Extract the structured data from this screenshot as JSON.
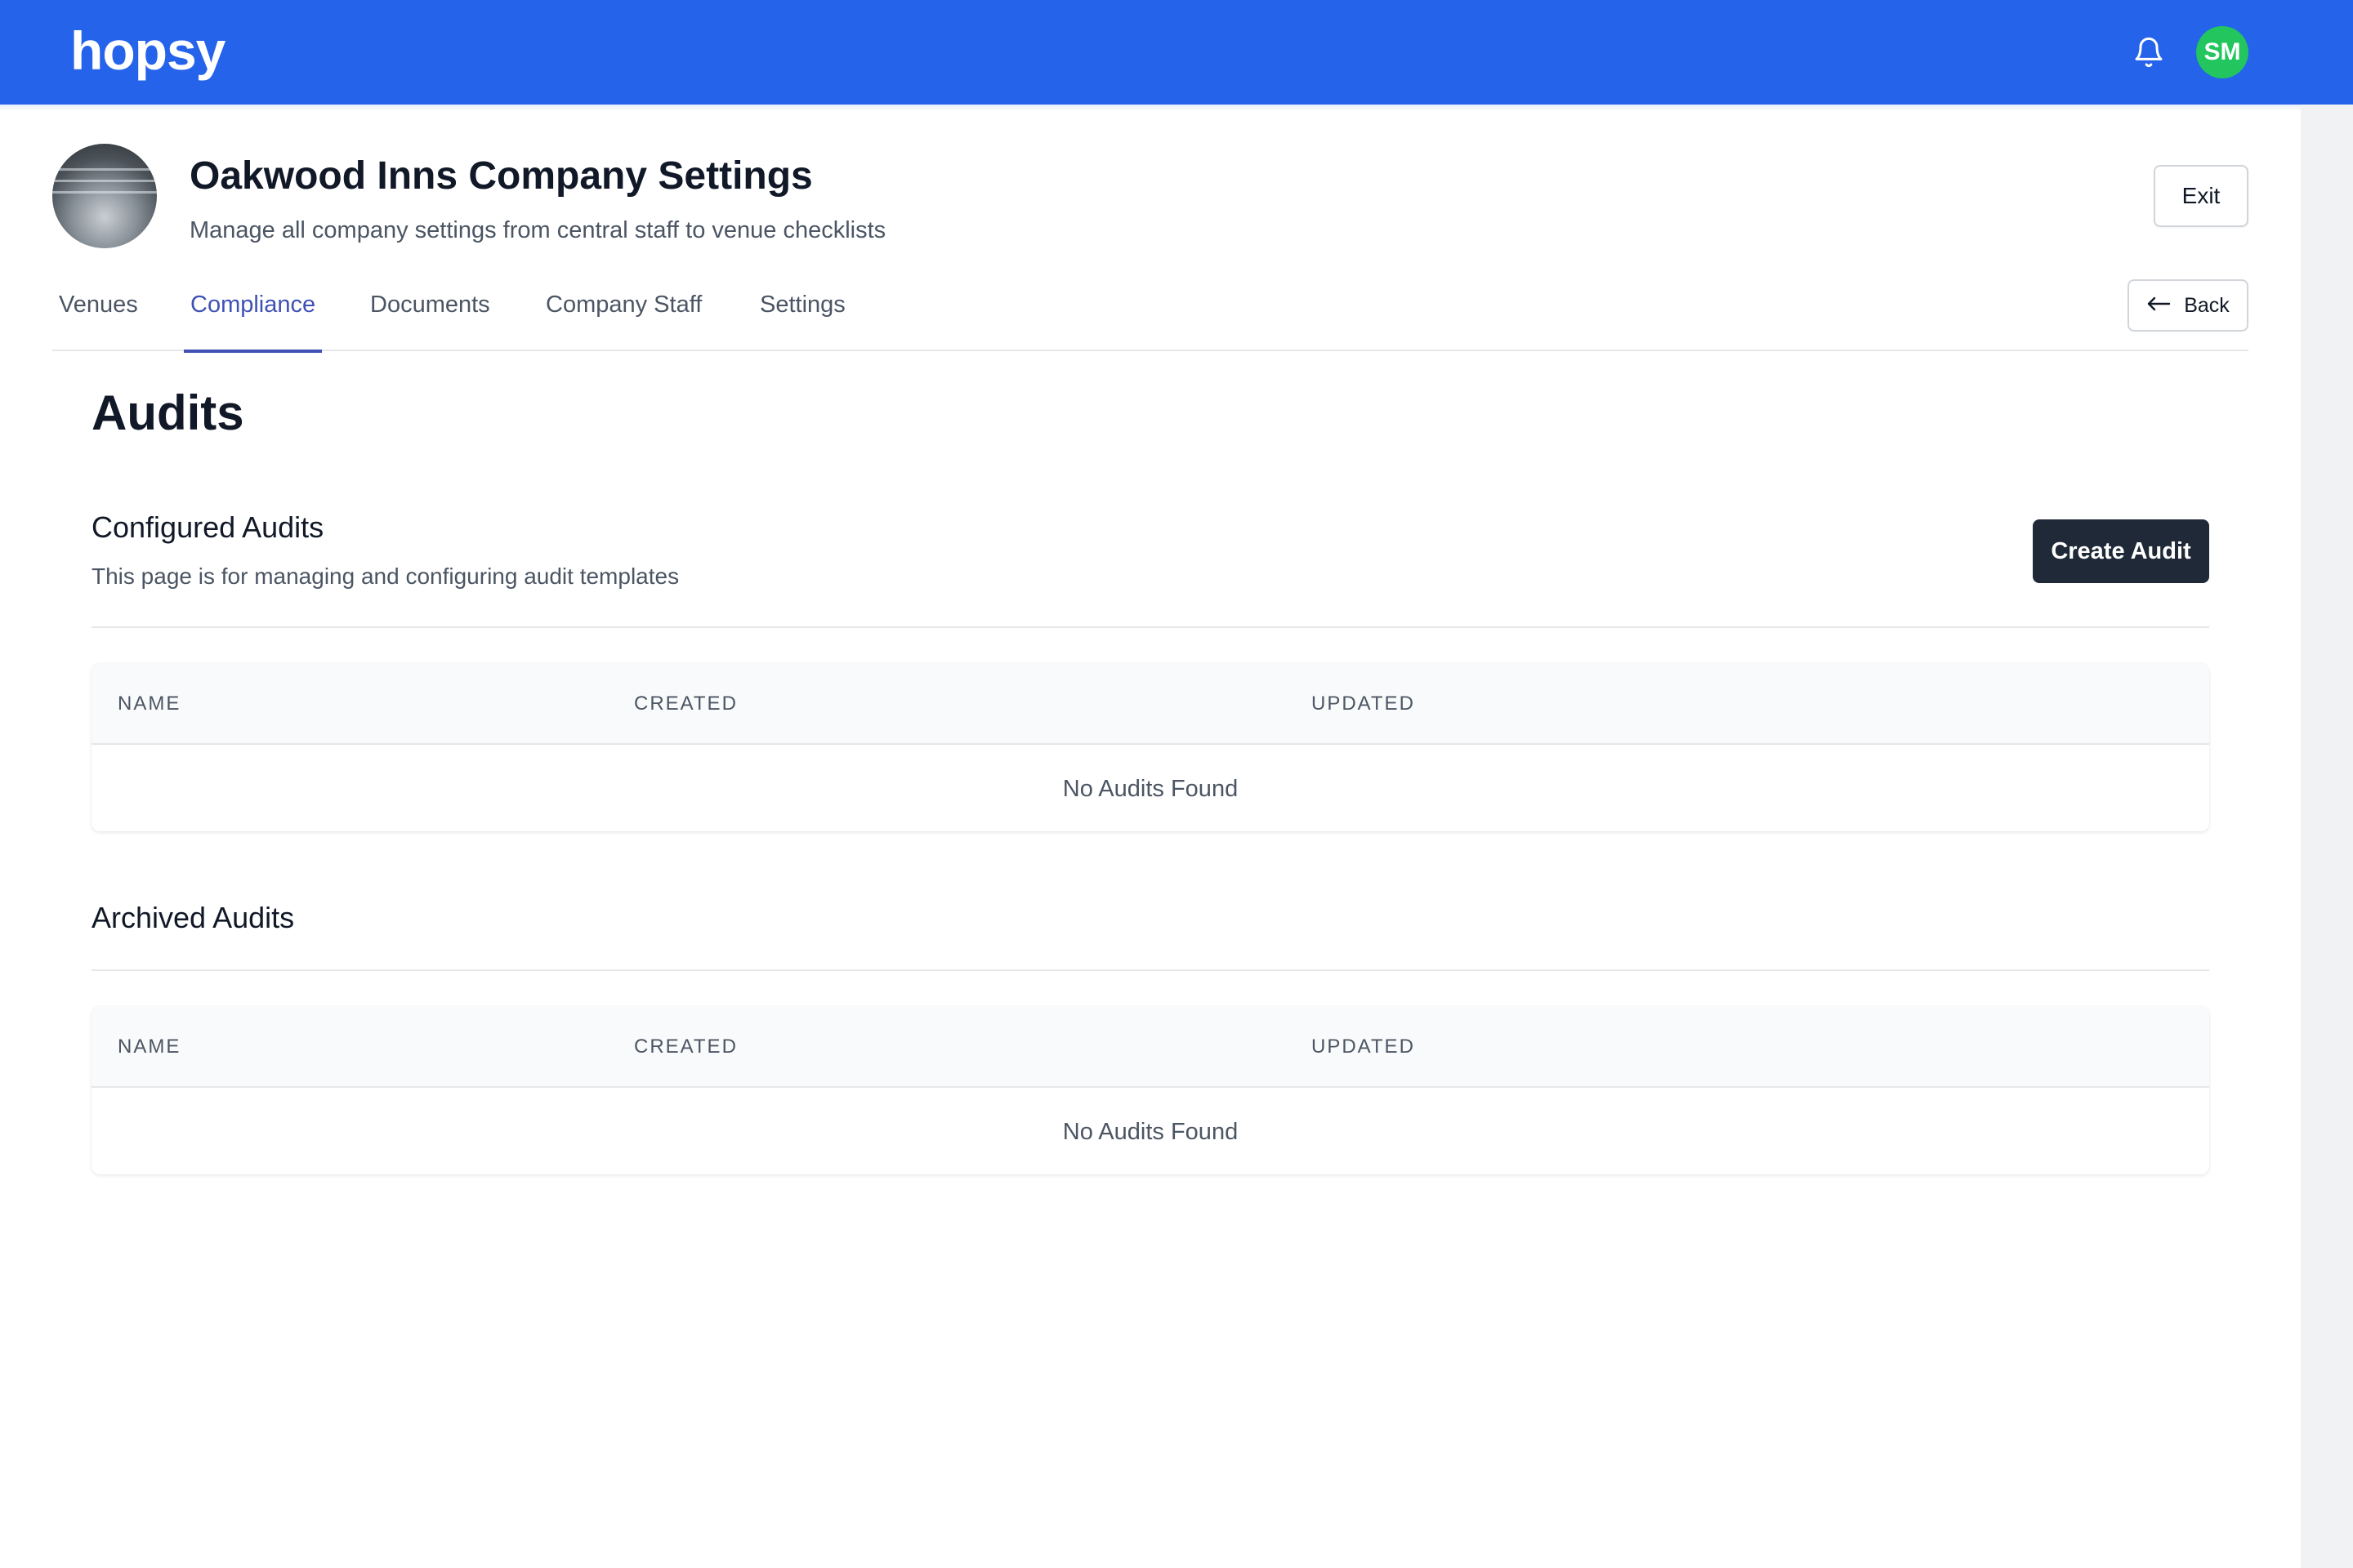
{
  "brand": {
    "logo_text": "hopsy",
    "primary_color": "#2563eb"
  },
  "topbar": {
    "bell_icon": "bell-icon",
    "user_initials": "SM",
    "avatar_color": "#22c55e"
  },
  "header": {
    "title": "Oakwood Inns Company Settings",
    "subtitle": "Manage all company settings from central staff to venue checklists",
    "exit_label": "Exit"
  },
  "tabs": [
    {
      "label": "Venues",
      "active": false
    },
    {
      "label": "Compliance",
      "active": true
    },
    {
      "label": "Documents",
      "active": false
    },
    {
      "label": "Company Staff",
      "active": false
    },
    {
      "label": "Settings",
      "active": false
    }
  ],
  "back_button": {
    "label": "Back",
    "icon": "arrow-left-icon"
  },
  "main": {
    "title": "Audits",
    "configured": {
      "title": "Configured Audits",
      "description": "This page is for managing and configuring audit templates",
      "create_label": "Create Audit",
      "columns": [
        "NAME",
        "CREATED",
        "UPDATED"
      ],
      "empty_text": "No Audits Found"
    },
    "archived": {
      "title": "Archived Audits",
      "columns": [
        "NAME",
        "CREATED",
        "UPDATED"
      ],
      "empty_text": "No Audits Found"
    }
  }
}
